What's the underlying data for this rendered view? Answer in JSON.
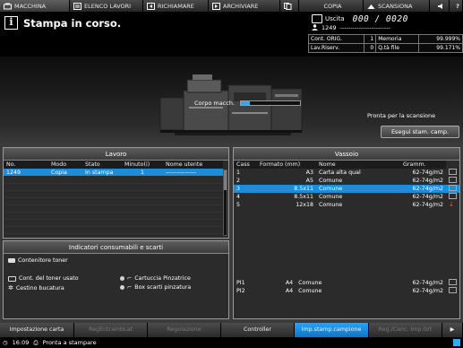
{
  "tabs": [
    {
      "label": "MACCHINA",
      "icon": "machine-icon",
      "active": true
    },
    {
      "label": "ELENCO LAVORI",
      "icon": "list-icon"
    },
    {
      "label": "RICHIAMARE",
      "icon": "recall-icon"
    },
    {
      "label": "ARCHIVIARE",
      "icon": "store-icon"
    },
    {
      "label": "COPIA",
      "icon": "copy-icon"
    },
    {
      "label": "SCANSIONA",
      "icon": "scan-icon"
    }
  ],
  "header": {
    "status": "Stampa in corso.",
    "uscita_label": "Uscita",
    "uscita_count": "000 / 0020",
    "user_id": "1249",
    "user_dashes": "------------------------",
    "stats": {
      "cont_orig_label": "Cont. ORIG.",
      "cont_orig": "1",
      "memoria_label": "Memoria",
      "memoria": "99.999%",
      "lav_riserv_label": "Lav.Riserv.",
      "lav_riserv": "0",
      "qta_file_label": "Q.tà file",
      "qta_file": "99.171%"
    }
  },
  "machine": {
    "corpo_label": "Corpo macch.",
    "corpo_level": 0.15,
    "pronta_scan": "Pronta per la scansione",
    "esegui_label": "Esegui stam. camp."
  },
  "lavoro": {
    "title": "Lavoro",
    "headers": [
      "No.",
      "Modo",
      "Stato",
      "Minuto(i)",
      "Nome utente"
    ],
    "rows": [
      {
        "no": "1249",
        "modo": "Copia",
        "stato": "In stampa",
        "minuti": "1",
        "nome": "---------------"
      }
    ]
  },
  "consumabili": {
    "title": "Indicatori consumabili e scarti",
    "toner": "Contenitore toner",
    "toner_usato": "Cont. del toner usato",
    "cestino": "Cestino bucatura",
    "cartuccia": "Cartuccia Pinzatrice",
    "box_scarti": "Box scarti pinzatura"
  },
  "vassoio": {
    "title": "Vassoio",
    "headers": [
      "Cass",
      "Formato (mm)",
      "Nome",
      "Gramm."
    ],
    "rows": [
      {
        "cass": "1",
        "formato": "A3",
        "nome": "Carta alta qual",
        "gramm": "62-74g/m2"
      },
      {
        "cass": "2",
        "formato": "A5",
        "nome": "Comune",
        "gramm": "62-74g/m2"
      },
      {
        "cass": "3",
        "formato": "8.5x11",
        "nome": "Comune",
        "gramm": "62-74g/m2",
        "selected": true
      },
      {
        "cass": "4",
        "formato": "8.5x11",
        "nome": "Comune",
        "gramm": "62-74g/m2"
      },
      {
        "cass": "5",
        "formato": "12x18",
        "nome": "Comune",
        "gramm": "62-74g/m2",
        "warn": true
      }
    ],
    "rows_bottom": [
      {
        "cass": "PI1",
        "formato": "A4",
        "nome": "Comune",
        "gramm": "62-74g/m2"
      },
      {
        "cass": "PI2",
        "formato": "A4",
        "nome": "Comune",
        "gramm": "62-74g/m2"
      }
    ]
  },
  "bottom_tabs": [
    {
      "label": "Impostazione carta"
    },
    {
      "label": "RegEntrambLat",
      "disabled": true
    },
    {
      "label": "Regolazione",
      "disabled": true
    },
    {
      "label": "Controller"
    },
    {
      "label": "Imp.stamp.campione",
      "active": true
    },
    {
      "label": "Reg./Canc. Imp.Grt",
      "disabled": true
    }
  ],
  "statusbar": {
    "time": "16:09",
    "message": "Pronta a stampare"
  }
}
